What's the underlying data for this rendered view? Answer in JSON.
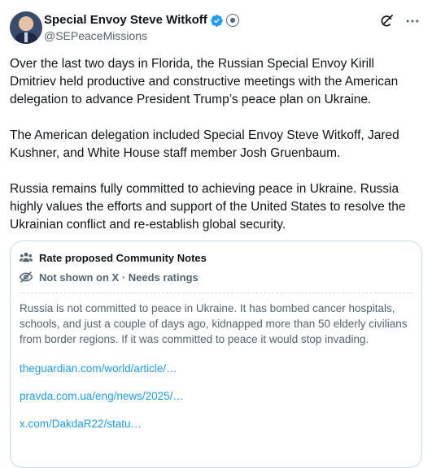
{
  "author": {
    "display_name": "Special Envoy Steve Witkoff",
    "handle": "@SEPeaceMissions"
  },
  "icons": {
    "verified": "verified-badge-icon",
    "government": "government-seal-icon",
    "grok": "grok-icon",
    "more": "more-icon",
    "community": "community-people-icon",
    "not_shown": "eye-slash-icon"
  },
  "colors": {
    "verified_badge": "#1d9bf0",
    "link": "#1d9bf0",
    "muted_text": "#536471"
  },
  "tweet": {
    "paragraphs": [
      "Over the last two days in Florida, the Russian Special Envoy Kirill Dmitriev held productive and constructive meetings with the American delegation to advance President Trump’s peace plan on Ukraine.",
      "The American delegation included Special Envoy Steve Witkoff, Jared Kushner, and White House staff member Josh Gruenbaum.",
      "Russia remains fully committed to achieving peace in Ukraine. Russia highly values the efforts and support of the United States to resolve the Ukrainian conflict and re-establish global security."
    ]
  },
  "community_note": {
    "title": "Rate proposed Community Notes",
    "status": "Not shown on X · Needs ratings",
    "text": "Russia is not committed to peace in Ukraine. It has bombed cancer hospitals, schools, and just a couple of days ago, kidnapped more than 50 elderly civilians from border regions. If it was committed to peace it would stop invading.",
    "links": [
      "theguardian.com/world/article/…",
      "pravda.com.ua/eng/news/2025/…",
      "x.com/DakdaR22/statu…"
    ]
  }
}
